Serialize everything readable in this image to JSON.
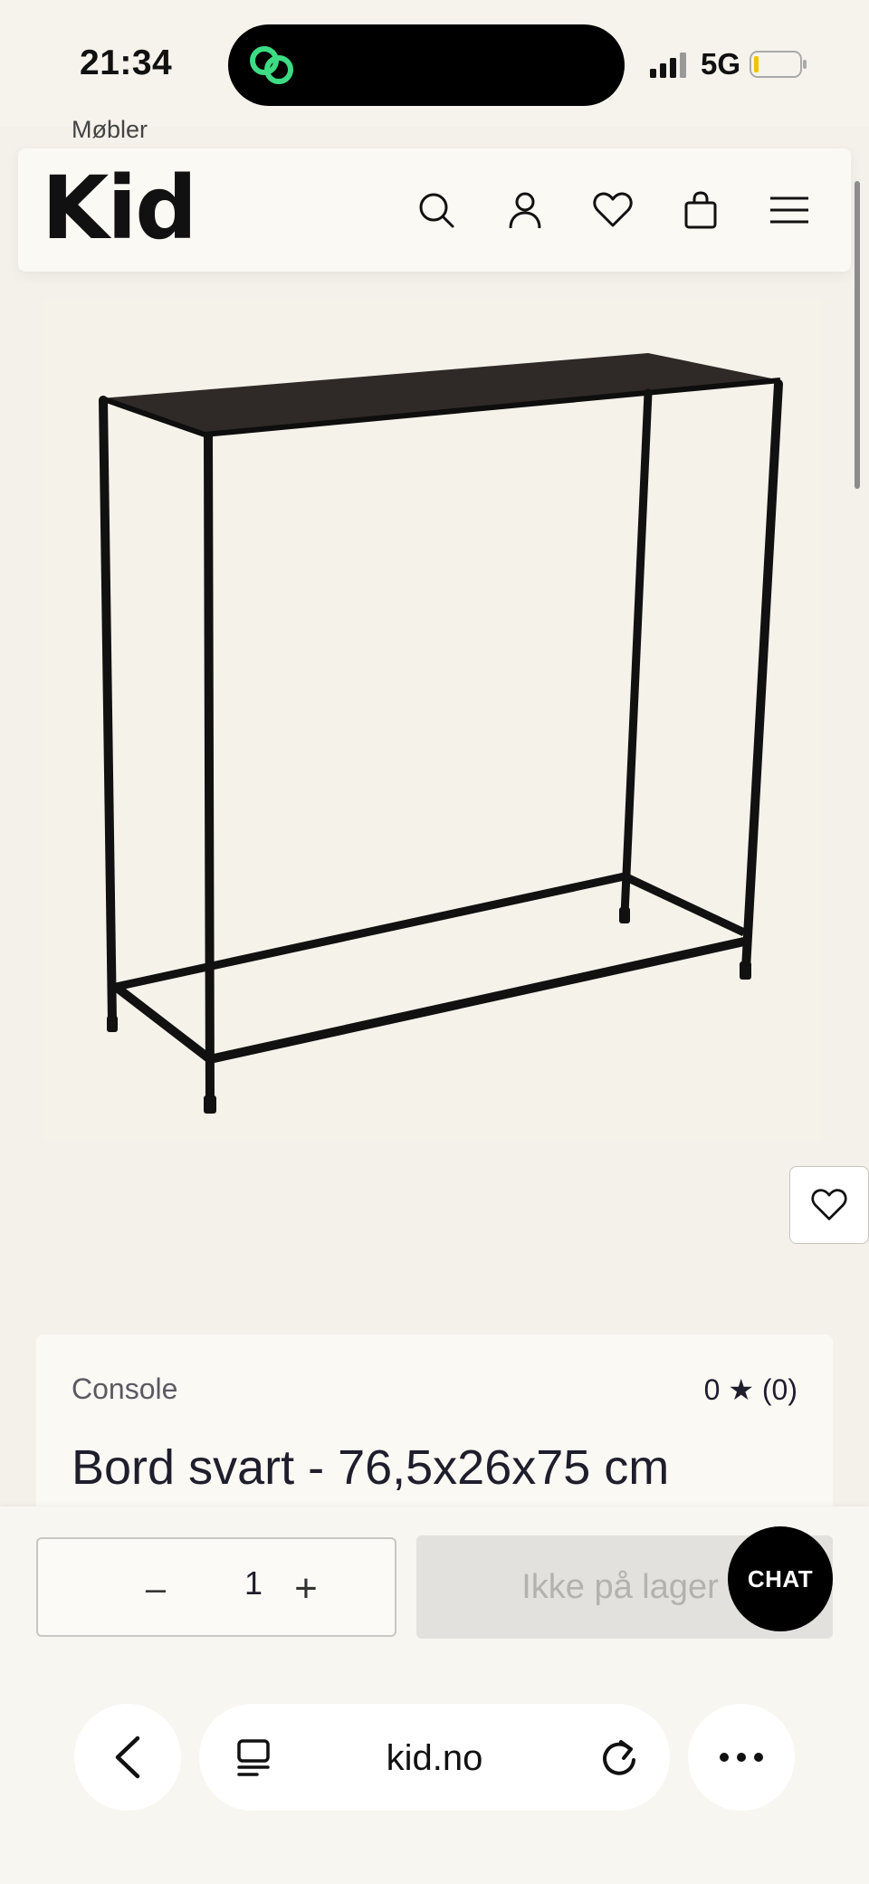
{
  "status_bar": {
    "time": "21:34",
    "network": "5G"
  },
  "breadcrumb": "Møbler",
  "header": {
    "logo": "Kid",
    "icons": [
      "search-icon",
      "user-icon",
      "heart-icon",
      "bag-icon",
      "menu-icon"
    ]
  },
  "product": {
    "image_alt": "Console table black",
    "brand": "Console",
    "rating": "0 ★ (0)",
    "title": "Bord svart - 76,5x26x75 cm"
  },
  "purchase": {
    "quantity": "1",
    "minus_label": "–",
    "plus_label": "+",
    "stock_button": "Ikke på lager",
    "chat_label": "CHAT"
  },
  "browser": {
    "url": "kid.no"
  },
  "colors": {
    "background": "#f4f1ea",
    "text": "#1f1e2c",
    "disabled": "#e3e1dd",
    "accent_green": "#3ddc84"
  }
}
